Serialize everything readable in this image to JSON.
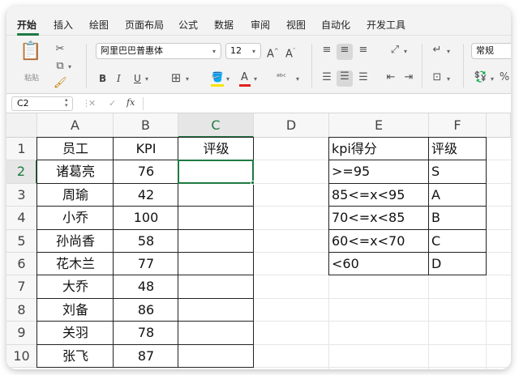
{
  "tabs": [
    "开始",
    "插入",
    "绘图",
    "页面布局",
    "公式",
    "数据",
    "审阅",
    "视图",
    "自动化",
    "开发工具"
  ],
  "ribbon": {
    "paste_label": "粘贴",
    "font_name": "阿里巴巴普惠体",
    "font_size": "12",
    "bold": "B",
    "italic": "I",
    "underline": "U",
    "grow_font": "A^",
    "shrink_font": "Aˇ",
    "number_format": "常规"
  },
  "formula_bar": {
    "cell_ref": "C2",
    "fx": "fx",
    "cancel": "✕",
    "enter": "✓"
  },
  "columns": [
    "A",
    "B",
    "C",
    "D",
    "E",
    "F"
  ],
  "rows": [
    "1",
    "2",
    "3",
    "4",
    "5",
    "6",
    "7",
    "8",
    "9",
    "10"
  ],
  "table1": {
    "headers": [
      "员工",
      "KPI",
      "评级"
    ],
    "rows": [
      [
        "诸葛亮",
        "76",
        ""
      ],
      [
        "周瑜",
        "42",
        ""
      ],
      [
        "小乔",
        "100",
        ""
      ],
      [
        "孙尚香",
        "58",
        ""
      ],
      [
        "花木兰",
        "77",
        ""
      ],
      [
        "大乔",
        "48",
        ""
      ],
      [
        "刘备",
        "86",
        ""
      ],
      [
        "关羽",
        "78",
        ""
      ],
      [
        "张飞",
        "87",
        ""
      ]
    ]
  },
  "table2": {
    "headers": [
      "kpi得分",
      "评级"
    ],
    "rows": [
      [
        ">=95",
        "S"
      ],
      [
        "85<=x<95",
        "A"
      ],
      [
        "70<=x<85",
        "B"
      ],
      [
        "60<=x<70",
        "C"
      ],
      [
        "<60",
        "D"
      ]
    ]
  },
  "selected_cell": "C2",
  "colors": {
    "accent": "#1f7a43",
    "ribbon_bg": "#f3f3f3"
  }
}
